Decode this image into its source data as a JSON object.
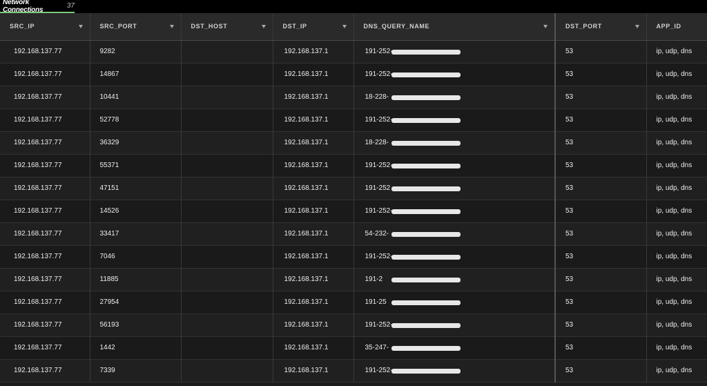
{
  "tab": {
    "title": "Network Connections",
    "count": "37"
  },
  "columns": [
    "SRC_IP",
    "SRC_PORT",
    "DST_HOST",
    "DST_IP",
    "DNS_QUERY_NAME",
    "DST_PORT",
    "APP_ID"
  ],
  "rows": [
    {
      "src_ip": "192.168.137.77",
      "src_port": "9282",
      "dst_host": "",
      "dst_ip": "192.168.137.1",
      "dns": "191-252-",
      "dst_port": "53",
      "app_id": "ip, udp, dns"
    },
    {
      "src_ip": "192.168.137.77",
      "src_port": "14867",
      "dst_host": "",
      "dst_ip": "192.168.137.1",
      "dns": "191-252-",
      "dst_port": "53",
      "app_id": "ip, udp, dns"
    },
    {
      "src_ip": "192.168.137.77",
      "src_port": "10441",
      "dst_host": "",
      "dst_ip": "192.168.137.1",
      "dns": "18-228-",
      "dst_port": "53",
      "app_id": "ip, udp, dns"
    },
    {
      "src_ip": "192.168.137.77",
      "src_port": "52778",
      "dst_host": "",
      "dst_ip": "192.168.137.1",
      "dns": "191-252-",
      "dst_port": "53",
      "app_id": "ip, udp, dns"
    },
    {
      "src_ip": "192.168.137.77",
      "src_port": "36329",
      "dst_host": "",
      "dst_ip": "192.168.137.1",
      "dns": "18-228-",
      "dst_port": "53",
      "app_id": "ip, udp, dns"
    },
    {
      "src_ip": "192.168.137.77",
      "src_port": "55371",
      "dst_host": "",
      "dst_ip": "192.168.137.1",
      "dns": "191-252-",
      "dst_port": "53",
      "app_id": "ip, udp, dns"
    },
    {
      "src_ip": "192.168.137.77",
      "src_port": "47151",
      "dst_host": "",
      "dst_ip": "192.168.137.1",
      "dns": "191-252",
      "dst_port": "53",
      "app_id": "ip, udp, dns"
    },
    {
      "src_ip": "192.168.137.77",
      "src_port": "14526",
      "dst_host": "",
      "dst_ip": "192.168.137.1",
      "dns": "191-252-",
      "dst_port": "53",
      "app_id": "ip, udp, dns"
    },
    {
      "src_ip": "192.168.137.77",
      "src_port": "33417",
      "dst_host": "",
      "dst_ip": "192.168.137.1",
      "dns": "54-232-",
      "dst_port": "53",
      "app_id": "ip, udp, dns"
    },
    {
      "src_ip": "192.168.137.77",
      "src_port": "7046",
      "dst_host": "",
      "dst_ip": "192.168.137.1",
      "dns": "191-252-",
      "dst_port": "53",
      "app_id": "ip, udp, dns"
    },
    {
      "src_ip": "192.168.137.77",
      "src_port": "11885",
      "dst_host": "",
      "dst_ip": "192.168.137.1",
      "dns": "191-2",
      "dst_port": "53",
      "app_id": "ip, udp, dns"
    },
    {
      "src_ip": "192.168.137.77",
      "src_port": "27954",
      "dst_host": "",
      "dst_ip": "192.168.137.1",
      "dns": "191-25",
      "dst_port": "53",
      "app_id": "ip, udp, dns"
    },
    {
      "src_ip": "192.168.137.77",
      "src_port": "56193",
      "dst_host": "",
      "dst_ip": "192.168.137.1",
      "dns": "191-252-",
      "dst_port": "53",
      "app_id": "ip, udp, dns"
    },
    {
      "src_ip": "192.168.137.77",
      "src_port": "1442",
      "dst_host": "",
      "dst_ip": "192.168.137.1",
      "dns": "35-247-",
      "dst_port": "53",
      "app_id": "ip, udp, dns"
    },
    {
      "src_ip": "192.168.137.77",
      "src_port": "7339",
      "dst_host": "",
      "dst_ip": "192.168.137.1",
      "dns": "191-252-",
      "dst_port": "53",
      "app_id": "ip, udp, dns"
    }
  ],
  "colors": {
    "accent": "#7ec97e",
    "background": "#1c1c1c",
    "header_bg": "#2a2a2a"
  }
}
